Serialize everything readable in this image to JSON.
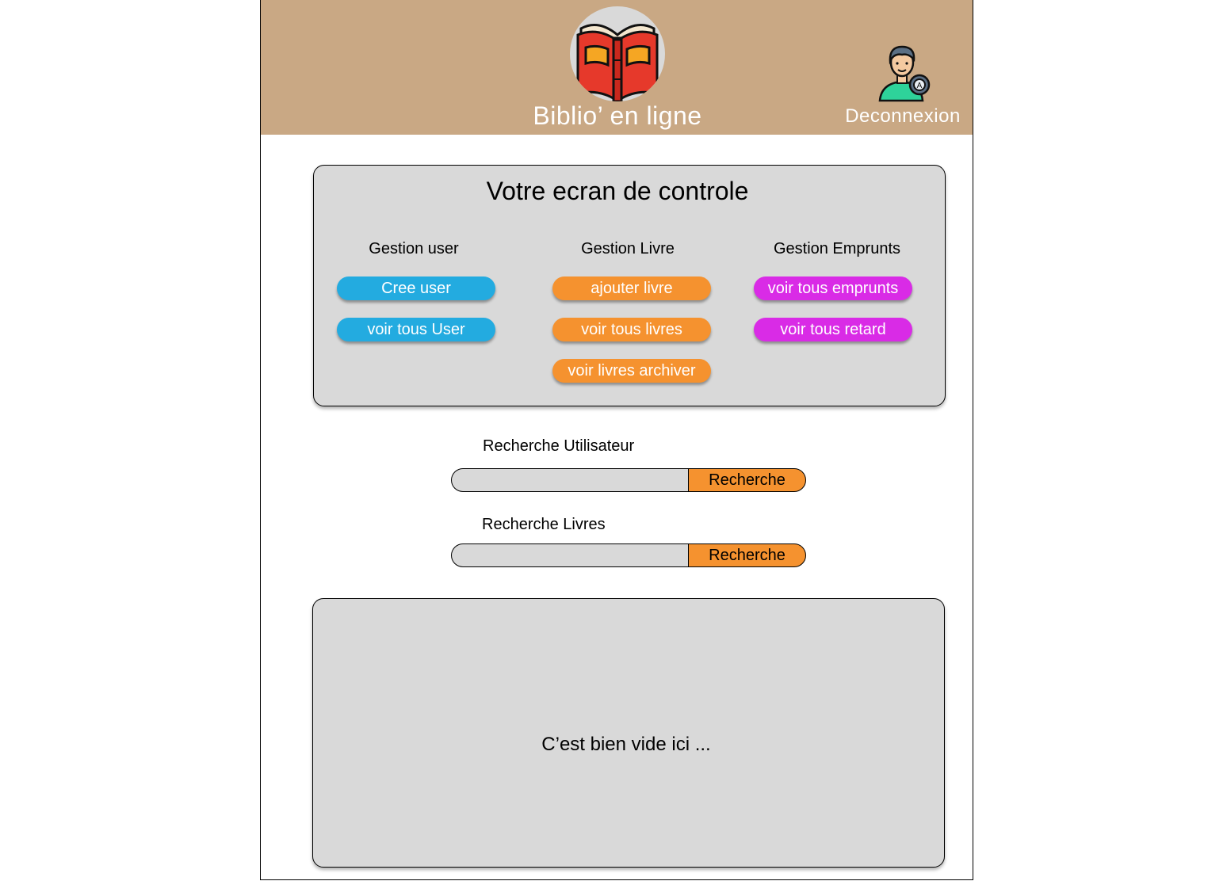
{
  "header": {
    "app_title": "Biblio’ en ligne",
    "logo_icon": "open-book-icon",
    "logout_icon": "user-avatar-icon",
    "logout_label": "Deconnexion",
    "background_color": "#c9a884"
  },
  "dashboard": {
    "title": "Votre ecran de controle",
    "columns": [
      {
        "heading": "Gestion user",
        "color": "#23abe0",
        "buttons": [
          "Cree user",
          "voir tous User"
        ]
      },
      {
        "heading": "Gestion Livre",
        "color": "#f5922f",
        "buttons": [
          "ajouter livre",
          "voir tous livres",
          "voir livres archiver"
        ]
      },
      {
        "heading": "Gestion Emprunts",
        "color": "#d92be6",
        "buttons": [
          "voir tous emprunts",
          "voir tous retard"
        ]
      }
    ]
  },
  "search_user": {
    "label": "Recherche Utilisateur",
    "value": "",
    "button_label": "Recherche"
  },
  "search_books": {
    "label": "Recherche Livres",
    "value": "",
    "button_label": "Recherche"
  },
  "results": {
    "empty_message": "C’est bien vide ici ..."
  }
}
